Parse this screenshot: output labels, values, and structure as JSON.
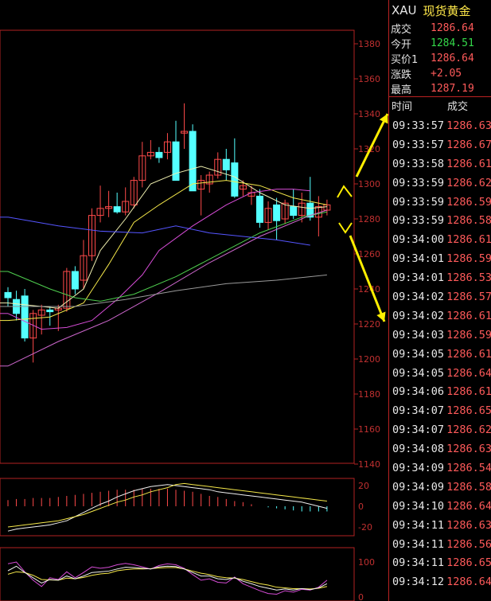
{
  "chart_data": {
    "type": "candlestick",
    "symbol_panel": {
      "symbol": "XAU",
      "name": "现货黄金"
    },
    "price_axis": {
      "ticks": [
        1140,
        1160,
        1180,
        1200,
        1220,
        1240,
        1260,
        1280,
        1300,
        1320,
        1340,
        1360,
        1380
      ],
      "ylim": [
        1140,
        1388
      ]
    },
    "candles": [
      {
        "o": 1238,
        "h": 1241,
        "l": 1230,
        "c": 1235
      },
      {
        "o": 1234,
        "h": 1239,
        "l": 1222,
        "c": 1226
      },
      {
        "o": 1236,
        "h": 1240,
        "l": 1210,
        "c": 1212
      },
      {
        "o": 1212,
        "h": 1228,
        "l": 1198,
        "c": 1226
      },
      {
        "o": 1225,
        "h": 1231,
        "l": 1214,
        "c": 1228
      },
      {
        "o": 1228,
        "h": 1230,
        "l": 1219,
        "c": 1227
      },
      {
        "o": 1228,
        "h": 1231,
        "l": 1216,
        "c": 1229
      },
      {
        "o": 1229,
        "h": 1252,
        "l": 1227,
        "c": 1250
      },
      {
        "o": 1250,
        "h": 1253,
        "l": 1237,
        "c": 1240
      },
      {
        "o": 1245,
        "h": 1268,
        "l": 1240,
        "c": 1259
      },
      {
        "o": 1259,
        "h": 1286,
        "l": 1256,
        "c": 1282
      },
      {
        "o": 1282,
        "h": 1299,
        "l": 1278,
        "c": 1286
      },
      {
        "o": 1286,
        "h": 1296,
        "l": 1281,
        "c": 1287
      },
      {
        "o": 1287,
        "h": 1295,
        "l": 1283,
        "c": 1284
      },
      {
        "o": 1284,
        "h": 1298,
        "l": 1282,
        "c": 1290
      },
      {
        "o": 1288,
        "h": 1304,
        "l": 1286,
        "c": 1302
      },
      {
        "o": 1302,
        "h": 1324,
        "l": 1298,
        "c": 1316
      },
      {
        "o": 1316,
        "h": 1325,
        "l": 1314,
        "c": 1318
      },
      {
        "o": 1318,
        "h": 1321,
        "l": 1312,
        "c": 1315
      },
      {
        "o": 1318,
        "h": 1329,
        "l": 1314,
        "c": 1324
      },
      {
        "o": 1324,
        "h": 1336,
        "l": 1302,
        "c": 1302
      },
      {
        "o": 1329,
        "h": 1346,
        "l": 1320,
        "c": 1330
      },
      {
        "o": 1330,
        "h": 1334,
        "l": 1296,
        "c": 1296
      },
      {
        "o": 1297,
        "h": 1305,
        "l": 1282,
        "c": 1302
      },
      {
        "o": 1300,
        "h": 1307,
        "l": 1295,
        "c": 1305
      },
      {
        "o": 1305,
        "h": 1318,
        "l": 1303,
        "c": 1314
      },
      {
        "o": 1314,
        "h": 1320,
        "l": 1302,
        "c": 1308
      },
      {
        "o": 1312,
        "h": 1326,
        "l": 1292,
        "c": 1293
      },
      {
        "o": 1297,
        "h": 1302,
        "l": 1293,
        "c": 1299
      },
      {
        "o": 1293,
        "h": 1299,
        "l": 1288,
        "c": 1295
      },
      {
        "o": 1293,
        "h": 1297,
        "l": 1275,
        "c": 1278
      },
      {
        "o": 1278,
        "h": 1290,
        "l": 1274,
        "c": 1286
      },
      {
        "o": 1288,
        "h": 1292,
        "l": 1268,
        "c": 1279
      },
      {
        "o": 1280,
        "h": 1291,
        "l": 1277,
        "c": 1289
      },
      {
        "o": 1287,
        "h": 1297,
        "l": 1280,
        "c": 1282
      },
      {
        "o": 1282,
        "h": 1295,
        "l": 1278,
        "c": 1289
      },
      {
        "o": 1289,
        "h": 1304,
        "l": 1279,
        "c": 1281
      },
      {
        "o": 1281,
        "h": 1293,
        "l": 1270,
        "c": 1287
      },
      {
        "o": 1285,
        "h": 1291,
        "l": 1282,
        "c": 1288
      }
    ],
    "moving_averages": [
      {
        "color": "#f0f0b0",
        "values": [
          [
            0,
            1232
          ],
          [
            6,
            1229
          ],
          [
            9,
            1240
          ],
          [
            11,
            1262
          ],
          [
            14,
            1280
          ],
          [
            17,
            1300
          ],
          [
            20,
            1306
          ],
          [
            23,
            1310
          ],
          [
            27,
            1304
          ],
          [
            30,
            1295
          ],
          [
            33,
            1288
          ],
          [
            36,
            1286
          ],
          [
            38,
            1287
          ]
        ]
      },
      {
        "color": "#f5e84a",
        "values": [
          [
            0,
            1222
          ],
          [
            5,
            1224
          ],
          [
            9,
            1232
          ],
          [
            12,
            1254
          ],
          [
            15,
            1278
          ],
          [
            18,
            1288
          ],
          [
            22,
            1300
          ],
          [
            26,
            1302
          ],
          [
            30,
            1299
          ],
          [
            34,
            1292
          ],
          [
            38,
            1288
          ]
        ]
      },
      {
        "color": "#d64cd6",
        "values": [
          [
            0,
            1226
          ],
          [
            4,
            1217
          ],
          [
            7,
            1218
          ],
          [
            10,
            1222
          ],
          [
            13,
            1234
          ],
          [
            16,
            1248
          ],
          [
            18,
            1262
          ],
          [
            22,
            1276
          ],
          [
            26,
            1288
          ],
          [
            29,
            1295
          ],
          [
            32,
            1297
          ],
          [
            34,
            1297
          ],
          [
            36,
            1296
          ]
        ]
      },
      {
        "color": "#4fcf4f",
        "values": [
          [
            0,
            1250
          ],
          [
            5,
            1240
          ],
          [
            8,
            1235
          ],
          [
            11,
            1233
          ],
          [
            15,
            1237
          ],
          [
            20,
            1247
          ],
          [
            26,
            1262
          ],
          [
            30,
            1272
          ],
          [
            35,
            1281
          ],
          [
            38,
            1284
          ]
        ]
      },
      {
        "color": "#5555ff",
        "values": [
          [
            0,
            1281
          ],
          [
            6,
            1276
          ],
          [
            11,
            1273
          ],
          [
            16,
            1272
          ],
          [
            20,
            1276
          ],
          [
            24,
            1272
          ],
          [
            28,
            1270
          ],
          [
            32,
            1268
          ],
          [
            36,
            1265
          ]
        ]
      },
      {
        "color": "#cc66cc",
        "values": [
          [
            0,
            1196
          ],
          [
            6,
            1210
          ],
          [
            12,
            1222
          ],
          [
            18,
            1238
          ],
          [
            24,
            1255
          ],
          [
            30,
            1270
          ],
          [
            36,
            1282
          ],
          [
            38,
            1285
          ]
        ]
      },
      {
        "color": "#9a9a9a",
        "values": [
          [
            8,
            1230
          ],
          [
            14,
            1234
          ],
          [
            20,
            1239
          ],
          [
            26,
            1243
          ],
          [
            32,
            1245
          ],
          [
            38,
            1248
          ]
        ]
      }
    ],
    "macd": {
      "ticks": [
        20,
        0,
        -20
      ],
      "ylim": [
        -30,
        28
      ],
      "histogram": [
        6,
        7,
        7,
        8,
        8,
        8,
        9,
        10,
        11,
        12,
        13,
        14,
        15,
        16,
        16,
        16,
        17,
        17,
        17,
        17,
        16,
        15,
        14,
        12,
        10,
        9,
        7,
        5,
        4,
        2,
        0,
        -1,
        -2,
        -3,
        -4,
        -5,
        -5,
        -5,
        -5
      ],
      "dif": [
        -24,
        -22,
        -21,
        -20,
        -19,
        -18,
        -16,
        -14,
        -10,
        -6,
        -2,
        2,
        5,
        9,
        12,
        15,
        17,
        19,
        20,
        21,
        20,
        19,
        18,
        17,
        16,
        14,
        13,
        12,
        11,
        10,
        9,
        8,
        7,
        6,
        5,
        4,
        2,
        0,
        -2
      ],
      "dea": [
        -20,
        -19,
        -18,
        -17,
        -16,
        -15,
        -14,
        -12,
        -10,
        -8,
        -5,
        -2,
        1,
        4,
        6,
        9,
        11,
        14,
        16,
        18,
        21,
        22,
        21,
        20,
        19,
        18,
        17,
        16,
        15,
        14,
        13,
        12,
        11,
        10,
        9,
        8,
        7,
        6,
        5
      ]
    },
    "kdj": {
      "ticks": [
        100,
        0
      ],
      "ylim": [
        -10,
        120
      ],
      "k": [
        75,
        88,
        70,
        55,
        40,
        50,
        48,
        60,
        52,
        60,
        70,
        72,
        74,
        80,
        85,
        84,
        82,
        80,
        86,
        88,
        87,
        80,
        70,
        60,
        60,
        52,
        50,
        55,
        45,
        38,
        30,
        25,
        20,
        23,
        20,
        24,
        21,
        26,
        38
      ],
      "d": [
        65,
        72,
        70,
        62,
        50,
        49,
        48,
        54,
        52,
        56,
        62,
        66,
        68,
        75,
        78,
        80,
        80,
        81,
        83,
        84,
        84,
        80,
        74,
        68,
        64,
        58,
        55,
        54,
        50,
        44,
        38,
        34,
        28,
        26,
        24,
        24,
        23,
        25,
        30
      ],
      "j": [
        95,
        100,
        72,
        48,
        30,
        55,
        50,
        72,
        55,
        70,
        86,
        82,
        85,
        92,
        96,
        92,
        86,
        80,
        90,
        95,
        92,
        82,
        64,
        48,
        52,
        42,
        40,
        57,
        38,
        28,
        18,
        10,
        8,
        18,
        14,
        22,
        20,
        28,
        48
      ]
    },
    "arrows_color": "#ffee00"
  },
  "quote": {
    "symbol": "XAU",
    "name": "现货黄金",
    "rows": [
      {
        "label": "成交",
        "value": "1286.64",
        "color": "red"
      },
      {
        "label": "今开",
        "value": "1284.51",
        "color": "green"
      },
      {
        "label": "买价1",
        "value": "1286.64",
        "color": "red"
      },
      {
        "label": "涨跌",
        "value": "+2.05",
        "color": "red"
      },
      {
        "label": "最高",
        "value": "1287.19",
        "color": "red"
      }
    ]
  },
  "ticks_table": {
    "headers": [
      "时间",
      "成交"
    ],
    "rows": [
      [
        "09:33:57",
        "1286.63"
      ],
      [
        "09:33:57",
        "1286.67"
      ],
      [
        "09:33:58",
        "1286.61"
      ],
      [
        "09:33:59",
        "1286.62"
      ],
      [
        "09:33:59",
        "1286.59"
      ],
      [
        "09:33:59",
        "1286.58"
      ],
      [
        "09:34:00",
        "1286.61"
      ],
      [
        "09:34:01",
        "1286.59"
      ],
      [
        "09:34:01",
        "1286.53"
      ],
      [
        "09:34:02",
        "1286.57"
      ],
      [
        "09:34:02",
        "1286.61"
      ],
      [
        "09:34:03",
        "1286.59"
      ],
      [
        "09:34:05",
        "1286.61"
      ],
      [
        "09:34:05",
        "1286.64"
      ],
      [
        "09:34:06",
        "1286.61"
      ],
      [
        "09:34:07",
        "1286.65"
      ],
      [
        "09:34:07",
        "1286.62"
      ],
      [
        "09:34:08",
        "1286.63"
      ],
      [
        "09:34:09",
        "1286.54"
      ],
      [
        "09:34:09",
        "1286.58"
      ],
      [
        "09:34:10",
        "1286.64"
      ],
      [
        "09:34:11",
        "1286.63"
      ],
      [
        "09:34:11",
        "1286.56"
      ],
      [
        "09:34:11",
        "1286.65"
      ],
      [
        "09:34:12",
        "1286.64"
      ]
    ]
  }
}
